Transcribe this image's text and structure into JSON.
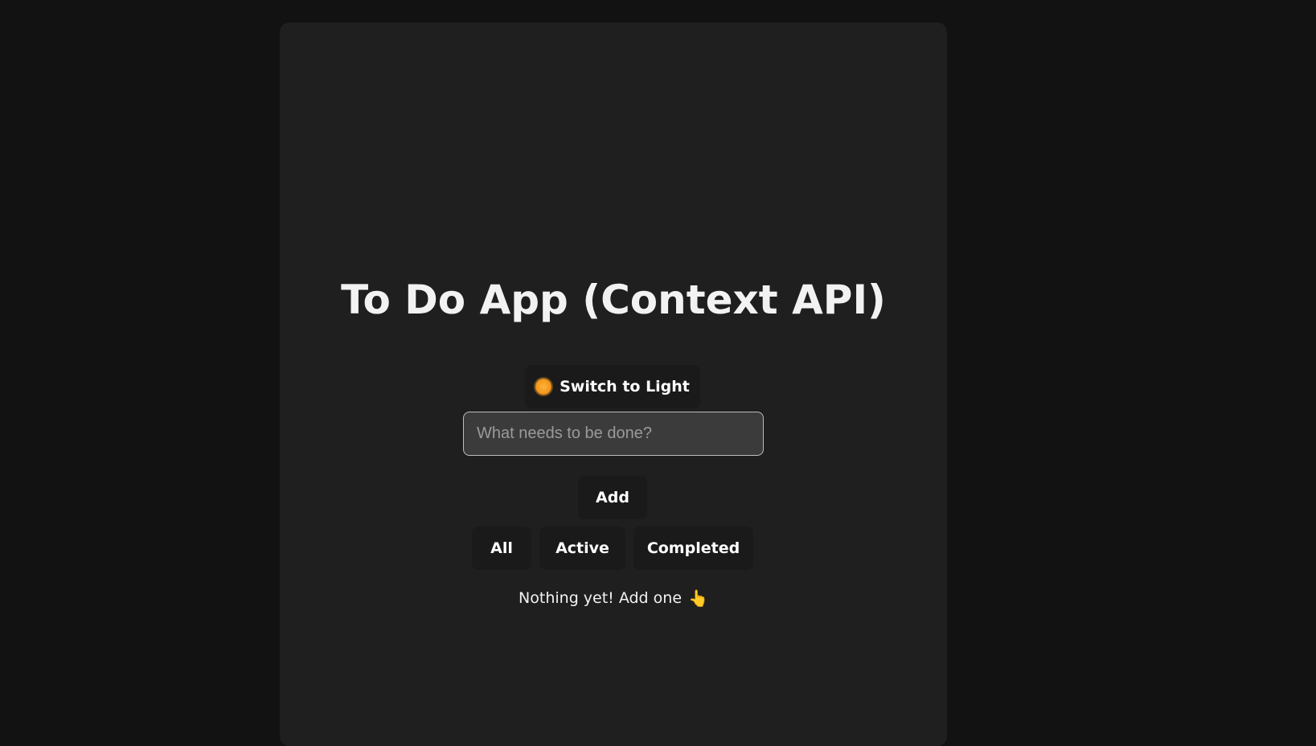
{
  "app": {
    "title": "To Do App (Context API)"
  },
  "theme_toggle": {
    "label": "Switch to Light",
    "icon": "sun-icon"
  },
  "new_todo": {
    "value": "",
    "placeholder": "What needs to be done?"
  },
  "add_button": {
    "label": "Add"
  },
  "filters": {
    "all": "All",
    "active": "Active",
    "completed": "Completed"
  },
  "empty_state": {
    "message": "Nothing yet! Add one",
    "icon": "pointing-hand-icon"
  },
  "colors": {
    "page_background": "#121212",
    "card_background": "#1f1f1f",
    "button_background": "#1a1a1a",
    "input_background": "#3b3b3b",
    "text": "#f2f2f2"
  }
}
